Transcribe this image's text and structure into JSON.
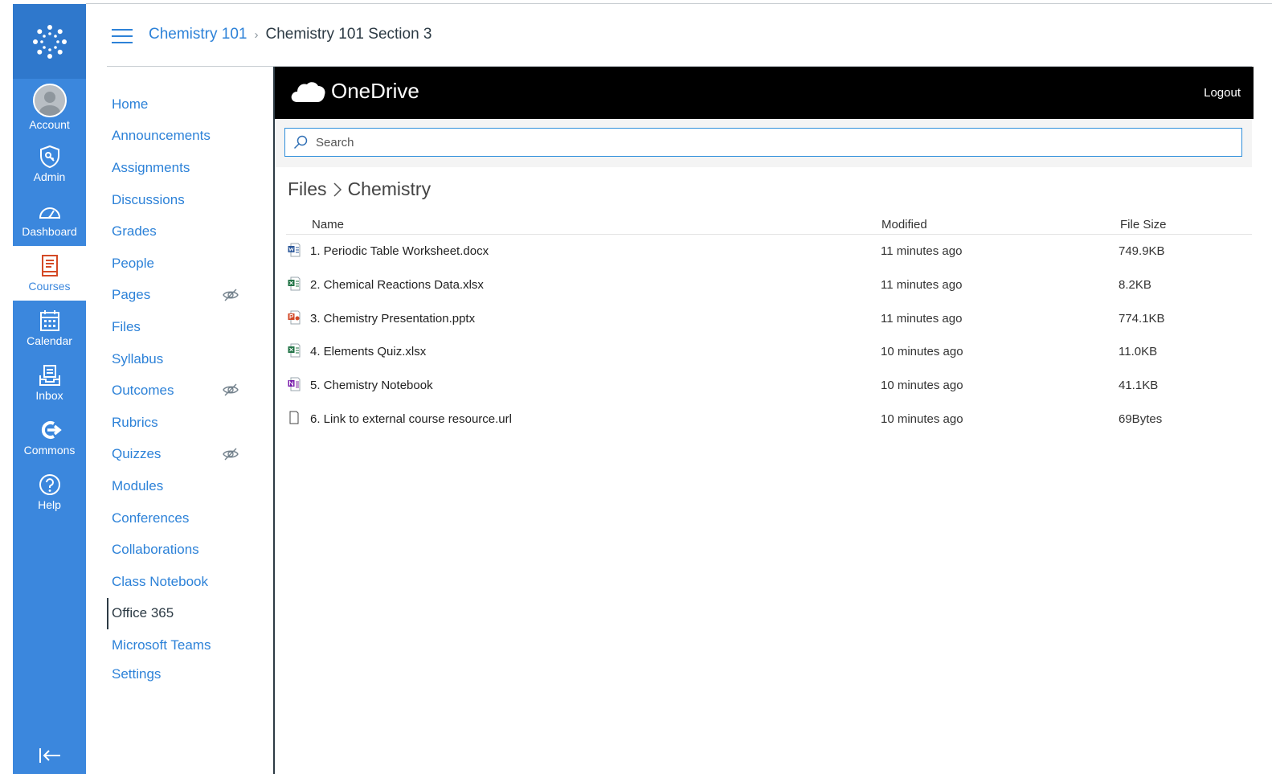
{
  "global_nav": {
    "items": [
      {
        "label": "Account",
        "icon": "user-avatar-icon"
      },
      {
        "label": "Admin",
        "icon": "shield-key-icon"
      },
      {
        "label": "Dashboard",
        "icon": "speedometer-icon"
      },
      {
        "label": "Courses",
        "icon": "book-icon",
        "active": true
      },
      {
        "label": "Calendar",
        "icon": "calendar-icon"
      },
      {
        "label": "Inbox",
        "icon": "inbox-icon"
      },
      {
        "label": "Commons",
        "icon": "commons-icon"
      },
      {
        "label": "Help",
        "icon": "question-circle-icon"
      }
    ]
  },
  "breadcrumb": {
    "course": "Chemistry 101",
    "separator": "›",
    "section": "Chemistry 101 Section 3"
  },
  "course_nav": {
    "items": [
      {
        "label": "Home"
      },
      {
        "label": "Announcements"
      },
      {
        "label": "Assignments"
      },
      {
        "label": "Discussions"
      },
      {
        "label": "Grades"
      },
      {
        "label": "People"
      },
      {
        "label": "Pages",
        "hidden_icon": true
      },
      {
        "label": "Files"
      },
      {
        "label": "Syllabus"
      },
      {
        "label": "Outcomes",
        "hidden_icon": true
      },
      {
        "label": "Rubrics"
      },
      {
        "label": "Quizzes",
        "hidden_icon": true
      },
      {
        "label": "Modules"
      },
      {
        "label": "Conferences"
      },
      {
        "label": "Collaborations"
      },
      {
        "label": "Class Notebook"
      },
      {
        "label": "Office 365",
        "active": true
      },
      {
        "label": "Microsoft Teams"
      },
      {
        "label": "Settings"
      }
    ]
  },
  "onedrive": {
    "brand": "OneDrive",
    "logout": "Logout",
    "search_placeholder": "Search",
    "path": {
      "root": "Files",
      "folder": "Chemistry"
    },
    "columns": {
      "name": "Name",
      "modified": "Modified",
      "size": "File Size"
    },
    "files": [
      {
        "name": "1. Periodic Table Worksheet.docx",
        "modified": "11 minutes ago",
        "size": "749.9KB",
        "type": "word"
      },
      {
        "name": "2. Chemical Reactions Data.xlsx",
        "modified": "11 minutes ago",
        "size": "8.2KB",
        "type": "excel"
      },
      {
        "name": "3. Chemistry Presentation.pptx",
        "modified": "11 minutes ago",
        "size": "774.1KB",
        "type": "powerpoint"
      },
      {
        "name": "4. Elements Quiz.xlsx",
        "modified": "10 minutes ago",
        "size": "11.0KB",
        "type": "excel"
      },
      {
        "name": "5. Chemistry Notebook",
        "modified": "10 minutes ago",
        "size": "41.1KB",
        "type": "onenote"
      },
      {
        "name": "6. Link to external course resource.url",
        "modified": "10 minutes ago",
        "size": "69Bytes",
        "type": "generic"
      }
    ]
  },
  "colors": {
    "nav_blue": "#3b87dd",
    "link_blue": "#2d82d8",
    "text_dark": "#2d3b45",
    "word": "#2b579a",
    "excel": "#217346",
    "powerpoint": "#d24726",
    "onenote": "#7719aa"
  }
}
